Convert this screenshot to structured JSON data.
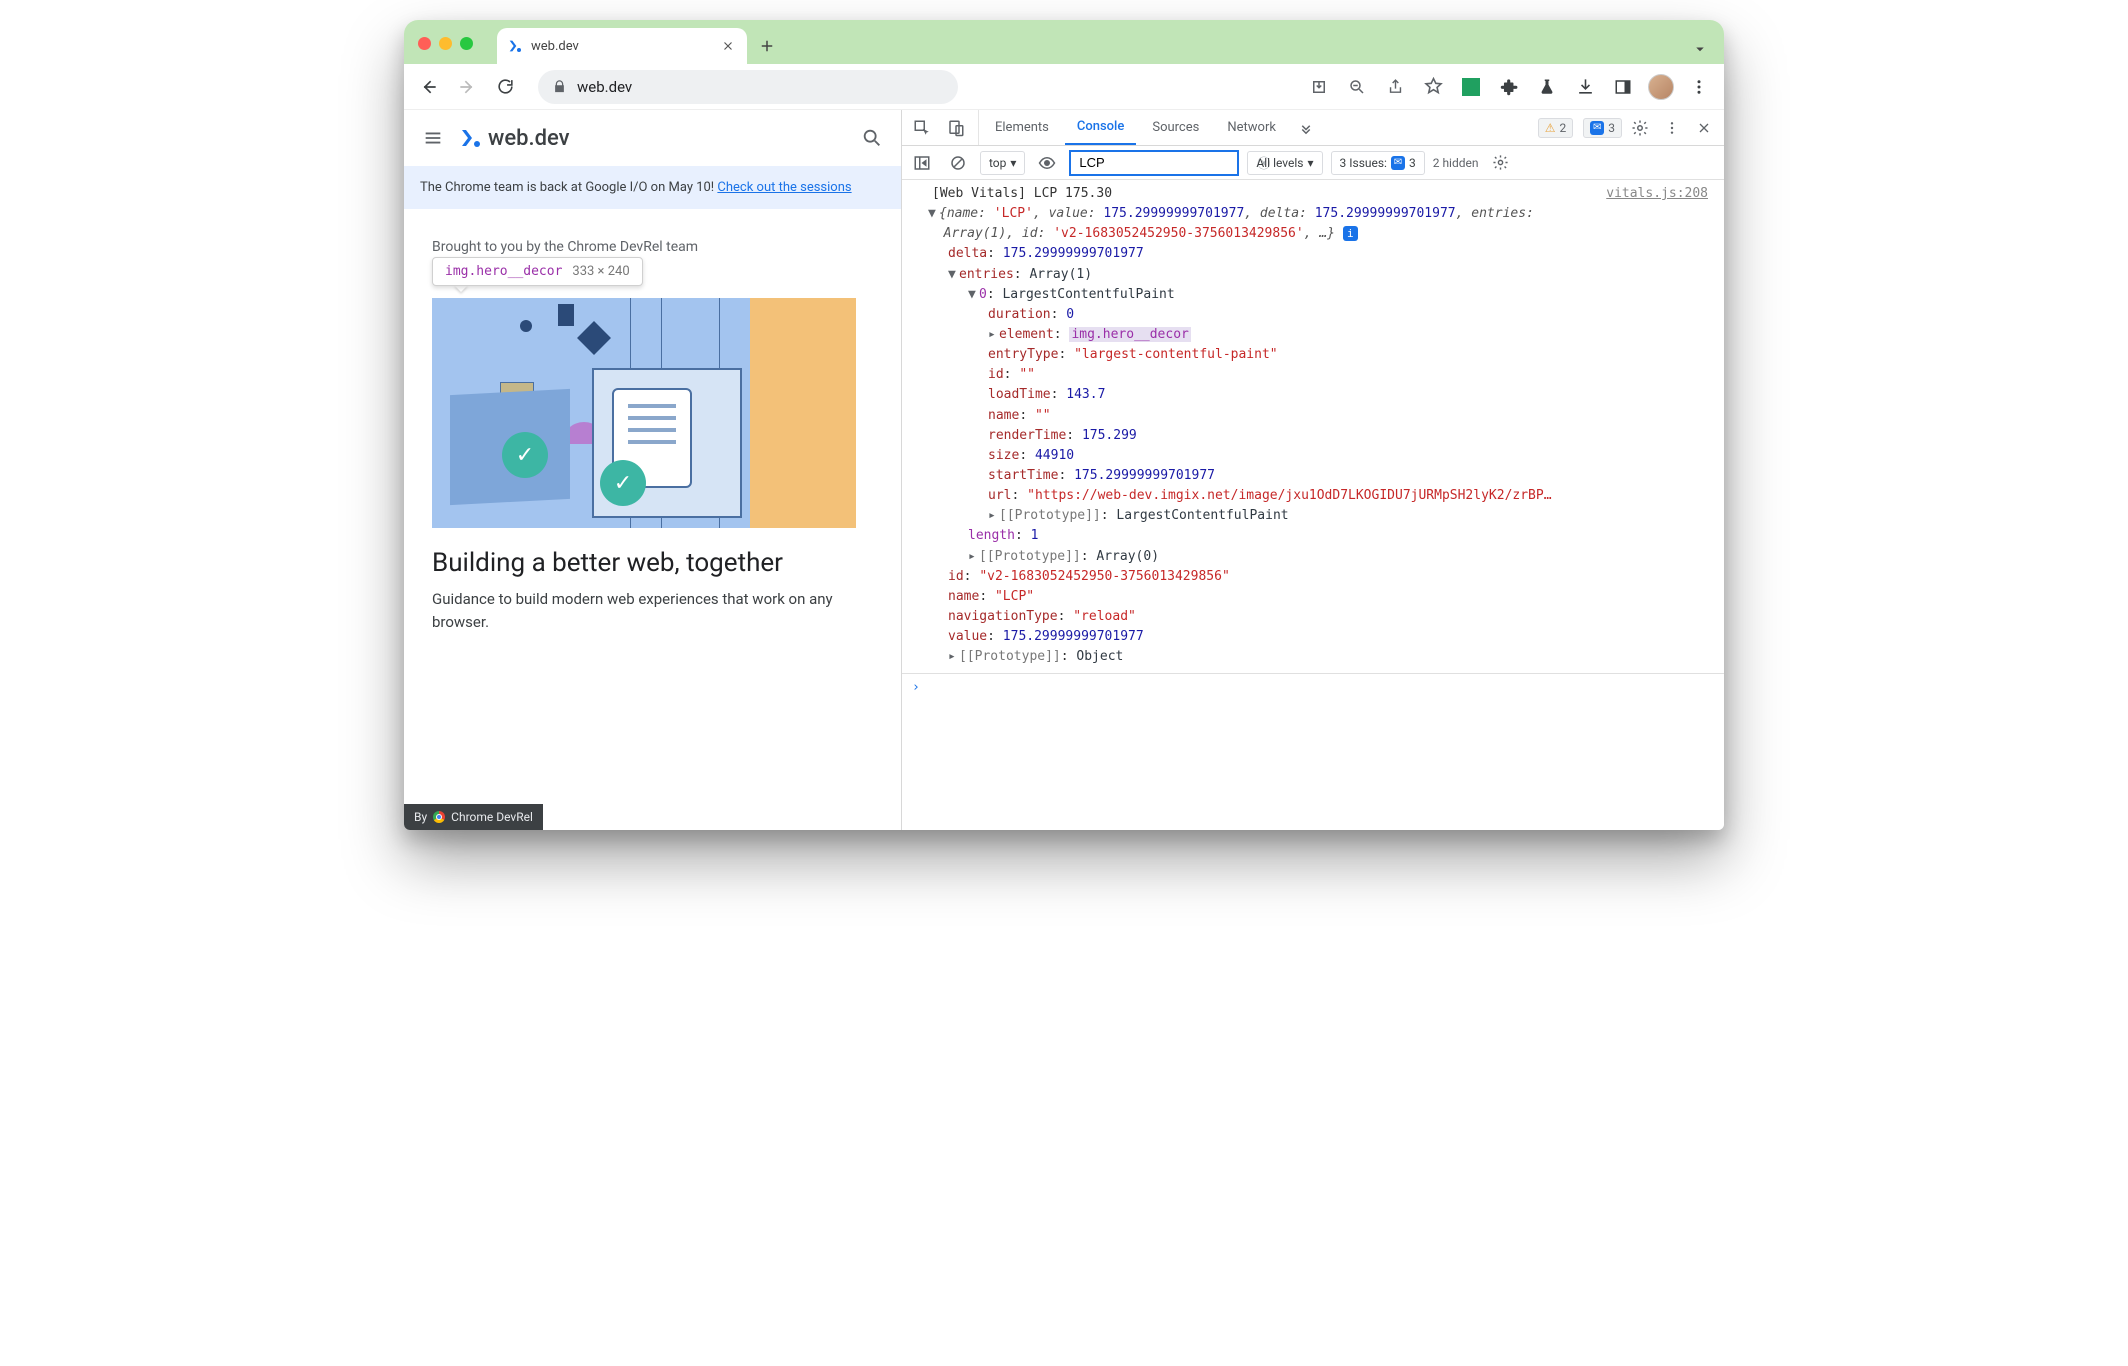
{
  "browser": {
    "tab_title": "web.dev",
    "url": "web.dev",
    "traffic": {
      "close": "close",
      "min": "min",
      "max": "max"
    }
  },
  "toolbar_icons": {
    "back": "←",
    "forward": "→",
    "reload": "⟳"
  },
  "page": {
    "site_name": "web.dev",
    "banner_prefix": "The Chrome team is back at Google I/O on May 10! ",
    "banner_link": "Check out the sessions",
    "brought": "Brought to you by the Chrome DevRel team",
    "inspect_selector": "img.hero__decor",
    "inspect_dims": "333 × 240",
    "headline": "Building a better web, together",
    "sub": "Guidance to build modern web experiences that work on any browser.",
    "devrel_pill_by": "By",
    "devrel_pill_label": "Chrome DevRel"
  },
  "devtools": {
    "tabs": [
      "Elements",
      "Console",
      "Sources",
      "Network"
    ],
    "active_tab": "Console",
    "status_warn": "2",
    "status_msg": "3",
    "context_label": "top",
    "filter_value": "LCP",
    "levels_label": "All levels",
    "issues_label": "3 Issues:",
    "issues_msg_count": "3",
    "hidden_label": "2 hidden",
    "source_link": "vitals.js:208",
    "log_title_prefix": "[Web Vitals]",
    "log_title_rest": "LCP 175.30",
    "summary": {
      "name": "'LCP'",
      "value": "175.29999999701977",
      "delta": "175.29999999701977",
      "entries": "Array(1)",
      "id": "'v2-1683052452950-3756013429856'"
    },
    "obj": {
      "delta": "175.29999999701977",
      "entries_label": "Array(1)",
      "entry0_type": "LargestContentfulPaint",
      "duration": "0",
      "element": "img.hero__decor",
      "entryType": "\"largest-contentful-paint\"",
      "id_empty": "\"\"",
      "loadTime": "143.7",
      "name_empty": "\"\"",
      "renderTime": "175.299",
      "size": "44910",
      "startTime": "175.29999999701977",
      "url": "\"https://web-dev.imgix.net/image/jxu1OdD7LKOGIDU7jURMpSH2lyK2/zrBP…",
      "proto_lcp": "LargestContentfulPaint",
      "length": "1",
      "proto_arr": "Array(0)",
      "id_full": "\"v2-1683052452950-3756013429856\"",
      "name_full": "\"LCP\"",
      "navType": "\"reload\"",
      "value_full": "175.29999999701977",
      "proto_obj": "Object"
    }
  }
}
